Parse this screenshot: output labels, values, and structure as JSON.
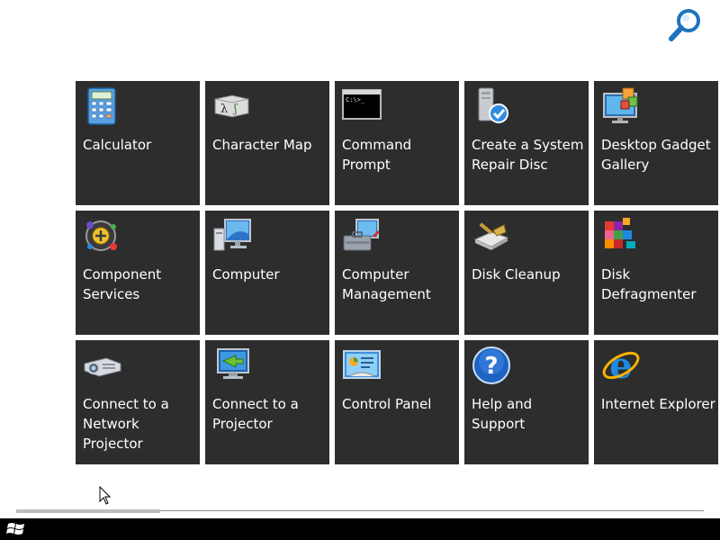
{
  "search": {
    "icon": "search-icon"
  },
  "tiles": [
    {
      "label": "Calculator",
      "icon": "calculator-icon"
    },
    {
      "label": "Character Map",
      "icon": "character-map-icon"
    },
    {
      "label": "Command\nPrompt",
      "icon": "command-prompt-icon"
    },
    {
      "label": "Create a System\nRepair Disc",
      "icon": "repair-disc-icon"
    },
    {
      "label": "Desktop Gadget\nGallery",
      "icon": "gadget-gallery-icon"
    },
    {
      "label": "Component\nServices",
      "icon": "component-services-icon"
    },
    {
      "label": "Computer",
      "icon": "computer-icon"
    },
    {
      "label": "Computer\nManagement",
      "icon": "computer-management-icon"
    },
    {
      "label": "Disk Cleanup",
      "icon": "disk-cleanup-icon"
    },
    {
      "label": "Disk\nDefragmenter",
      "icon": "disk-defragmenter-icon"
    },
    {
      "label": "Connect to a\nNetwork\nProjector",
      "icon": "network-projector-icon"
    },
    {
      "label": "Connect to a\nProjector",
      "icon": "projector-icon"
    },
    {
      "label": "Control Panel",
      "icon": "control-panel-icon"
    },
    {
      "label": "Help and\nSupport",
      "icon": "help-icon"
    },
    {
      "label": "Internet Explorer",
      "icon": "internet-explorer-icon"
    }
  ],
  "scrollbar": {
    "position": 0.0,
    "visible_fraction": 0.21
  },
  "taskbar": {
    "start_icon": "windows-logo-icon"
  },
  "colors": {
    "tile_background": "#2d2d2d",
    "tile_text": "#ffffff",
    "taskbar": "#000000",
    "search_accent": "#1e73be"
  }
}
